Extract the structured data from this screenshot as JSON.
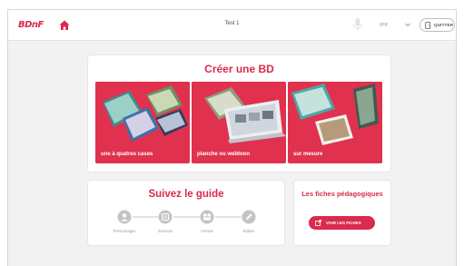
{
  "app": {
    "logo": "BDnF",
    "document_title": "Test 1",
    "user": "gxg"
  },
  "topbar": {
    "quit_label": "QUITTER"
  },
  "create": {
    "title": "Créer une BD",
    "cards": [
      {
        "label": "une à quatres cases"
      },
      {
        "label": "planche ou webtoon"
      },
      {
        "label": "sur mesure"
      }
    ]
  },
  "guide": {
    "title": "Suivez le guide",
    "steps": [
      {
        "label": "Personnages",
        "icon": "character-icon"
      },
      {
        "label": "Scénario",
        "icon": "script-icon"
      },
      {
        "label": "Format",
        "icon": "format-icon"
      },
      {
        "label": "Édition",
        "icon": "edit-icon"
      }
    ]
  },
  "fiches": {
    "title": "Les fiches pédagogiques",
    "button_label": "VOIR LES FICHES"
  },
  "colors": {
    "accent": "#d92b4b",
    "card_bg": "#e0314f",
    "background": "#f2f2f3"
  }
}
